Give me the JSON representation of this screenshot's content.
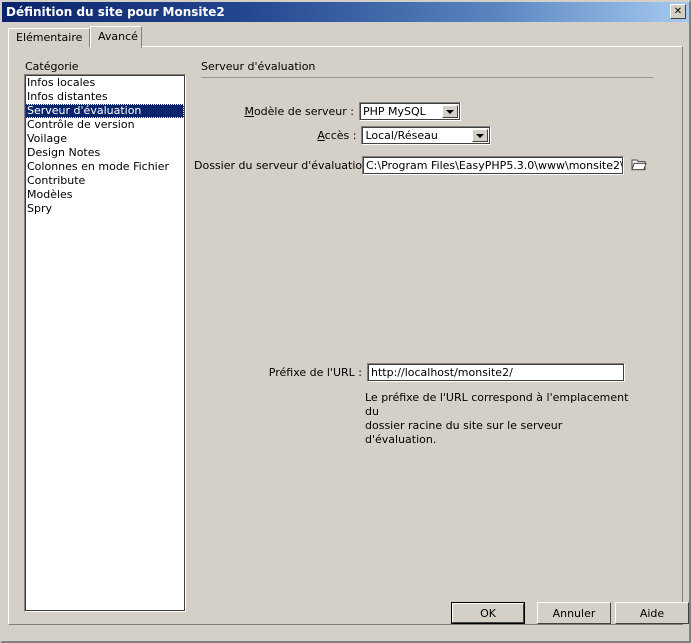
{
  "window": {
    "title": "Définition du site pour Monsite2",
    "close_label": "✕"
  },
  "tabs": [
    {
      "label": "Elémentaire",
      "active": false
    },
    {
      "label": "Avancé",
      "active": true
    }
  ],
  "sidebar": {
    "label": "Catégorie",
    "items": [
      {
        "label": "Infos locales",
        "selected": false
      },
      {
        "label": "Infos distantes",
        "selected": false
      },
      {
        "label": "Serveur d'évaluation",
        "selected": true
      },
      {
        "label": "Contrôle de version",
        "selected": false
      },
      {
        "label": "Voilage",
        "selected": false
      },
      {
        "label": "Design Notes",
        "selected": false
      },
      {
        "label": "Colonnes en mode Fichier",
        "selected": false
      },
      {
        "label": "Contribute",
        "selected": false
      },
      {
        "label": "Modèles",
        "selected": false
      },
      {
        "label": "Spry",
        "selected": false
      }
    ]
  },
  "main": {
    "section_title": "Serveur d'évaluation",
    "server_model": {
      "label_pre": "M",
      "label_post": "odèle de serveur :",
      "value": "PHP MySQL"
    },
    "access": {
      "label_pre": "A",
      "label_post": "ccès :",
      "value": "Local/Réseau"
    },
    "folder": {
      "label": "Dossier du serveur d'évaluation :",
      "value": "C:\\Program Files\\EasyPHP5.3.0\\www\\monsite2\\"
    },
    "url_prefix": {
      "label": "Préfixe de l'URL :",
      "value": "http://localhost/monsite2/",
      "help_line1": "Le préfixe de l'URL correspond à l'emplacement du",
      "help_line2": "dossier racine du site sur le serveur d'évaluation."
    }
  },
  "footer": {
    "ok": "OK",
    "cancel": "Annuler",
    "help": "Aide"
  },
  "colors": {
    "face": "#d4d0c8",
    "title_start": "#0a246a",
    "title_end": "#a6caf0",
    "highlight": "#0a246a",
    "rule": "#9a968c"
  }
}
